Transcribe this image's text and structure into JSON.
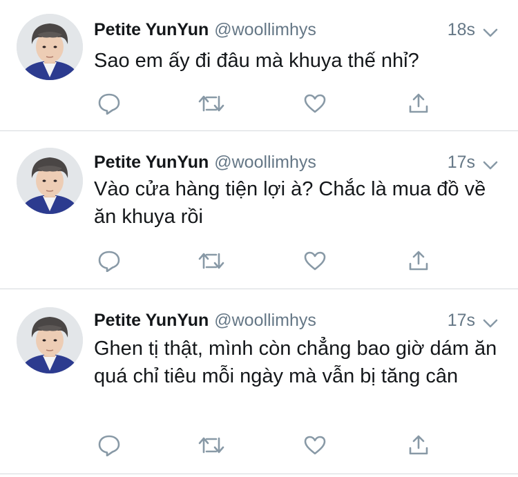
{
  "tweets": [
    {
      "name": "Petite YunYun",
      "handle": "@woollimhys",
      "time": "18s",
      "text": "Sao em ấy đi đâu mà khuya thế nhỉ?"
    },
    {
      "name": "Petite YunYun",
      "handle": "@woollimhys",
      "time": "17s",
      "text": "Vào cửa hàng tiện lợi à? Chắc là mua đồ về ăn khuya rồi"
    },
    {
      "name": "Petite YunYun",
      "handle": "@woollimhys",
      "time": "17s",
      "text": "Ghen tị thật, mình còn chẳng bao giờ dám ăn quá chỉ tiêu mỗi ngày mà vẫn bị tăng cân"
    }
  ],
  "icons": {
    "reply": "reply-icon",
    "retweet": "retweet-icon",
    "like": "like-icon",
    "share": "share-icon",
    "caret": "chevron-down-icon"
  },
  "colors": {
    "text": "#14171a",
    "secondary": "#657786",
    "icon": "#8899a6",
    "divider": "#d5d9dd"
  }
}
